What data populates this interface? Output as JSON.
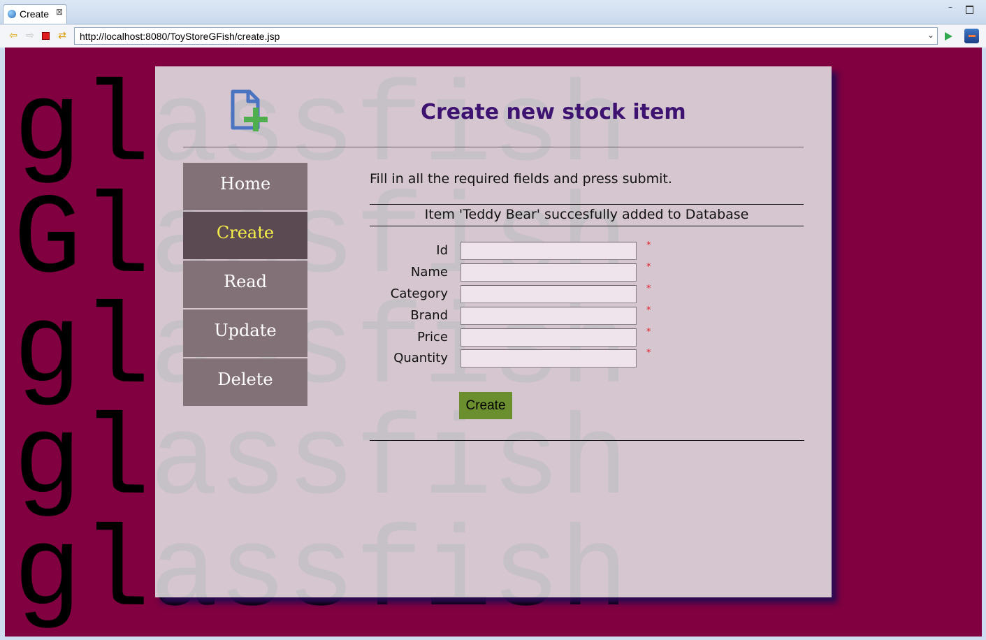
{
  "browser": {
    "tab_title": "Create",
    "tab_close": "⊠",
    "url": "http://localhost:8080/ToyStoreGFish/create.jsp",
    "icons": [
      "globe-icon",
      "back-icon",
      "forward-icon",
      "stop-icon",
      "refresh-icon",
      "go-icon",
      "external-browser-icon"
    ]
  },
  "background": {
    "words": [
      "glassfish",
      "Glassfish",
      "glassfish",
      "glassfish",
      "glassfish"
    ],
    "color": "#800040"
  },
  "header": {
    "logo_icon": "new-document-plus-icon",
    "title": "Create new stock item"
  },
  "nav": {
    "items": [
      {
        "label": "Home"
      },
      {
        "label": "Create",
        "active": true
      },
      {
        "label": "Read"
      },
      {
        "label": "Update"
      },
      {
        "label": "Delete"
      }
    ]
  },
  "main": {
    "intro": "Fill in all the required fields and press submit.",
    "message": "Item 'Teddy Bear' succesfully added to Database",
    "fields": [
      {
        "label": "Id",
        "value": "",
        "required": "*"
      },
      {
        "label": "Name",
        "value": "",
        "required": "*"
      },
      {
        "label": "Category",
        "value": "",
        "required": "*"
      },
      {
        "label": "Brand",
        "value": "",
        "required": "*"
      },
      {
        "label": "Price",
        "value": "",
        "required": "*"
      },
      {
        "label": "Quantity",
        "value": "",
        "required": "*"
      }
    ],
    "submit_label": "Create"
  },
  "colors": {
    "title": "#3d1270",
    "nav_bg": "#837178",
    "nav_active_bg": "#5c4a52",
    "nav_active_text": "#f5ef4a",
    "button": "#6b8e2e",
    "required": "#e0202a"
  }
}
